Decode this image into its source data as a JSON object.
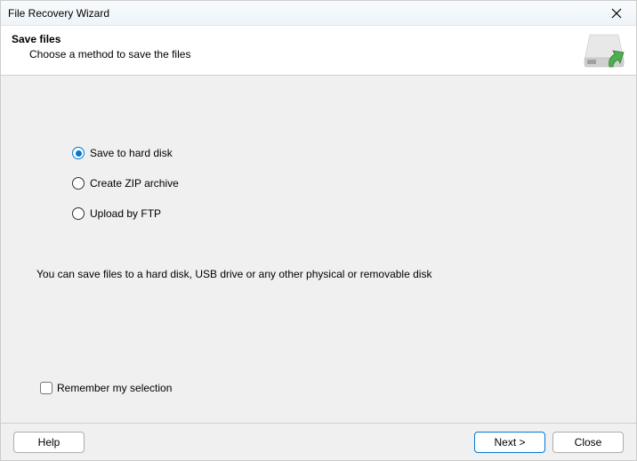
{
  "titlebar": {
    "title": "File Recovery Wizard"
  },
  "header": {
    "title": "Save files",
    "subtitle": "Choose a method to save the files"
  },
  "options": {
    "hard_disk": "Save to hard disk",
    "zip": "Create ZIP archive",
    "ftp": "Upload by FTP",
    "selected": "hard_disk"
  },
  "description": "You can save files to a hard disk, USB drive or any other physical or removable disk",
  "remember": {
    "label": "Remember my selection",
    "checked": false
  },
  "buttons": {
    "help": "Help",
    "next": "Next >",
    "close": "Close"
  }
}
